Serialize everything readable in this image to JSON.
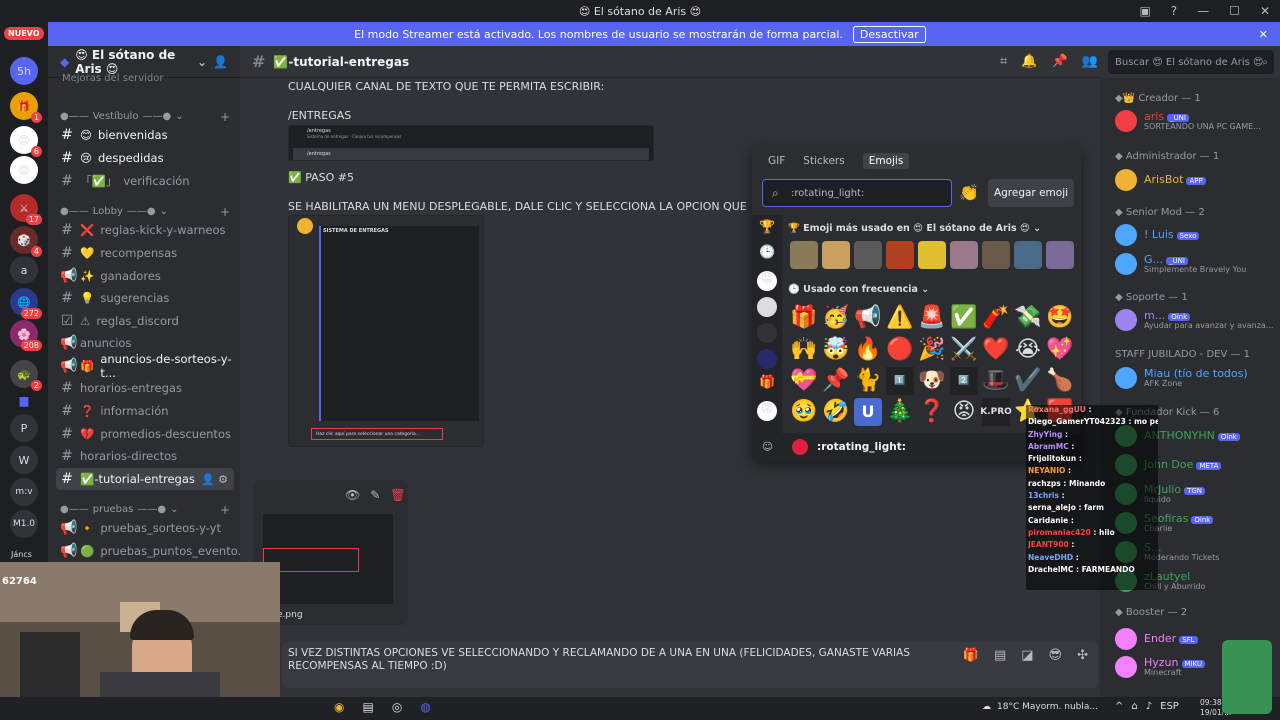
{
  "window": {
    "title": "😍 El sótano de Aris 😍"
  },
  "streamer": {
    "message": "El modo Streamer está activado. Los nombres de usuario se mostrarán de forma parcial.",
    "button": "Desactivar"
  },
  "guilds": {
    "nuevo": "NUEVO",
    "badges": [
      "1",
      "6",
      "17",
      "4",
      "272",
      "208",
      "2"
    ],
    "letters": [
      "a",
      "P",
      "W",
      "m:v",
      "M1.0",
      "Jáncs"
    ],
    "counter": "62764"
  },
  "server": {
    "name": "😍 El sótano de Aris 😍",
    "prev_item": "Mejoras del servidor"
  },
  "categories": {
    "vestibulo": "Vestíbulo",
    "lobby": "Lobby",
    "pruebas": "pruebas"
  },
  "channels": [
    {
      "label": "bienvenidas",
      "emoji": "😊"
    },
    {
      "label": "despedidas",
      "emoji": "😢"
    },
    {
      "label": "verificación",
      "emoji": "✅"
    },
    {
      "label": "reglas-kick-y-warneos",
      "emoji": "❌"
    },
    {
      "label": "recompensas",
      "emoji": "💛"
    },
    {
      "label": "ganadores",
      "emoji": "✨"
    },
    {
      "label": "sugerencias",
      "emoji": "💡"
    },
    {
      "label": "reglas_discord",
      "emoji": "⚠"
    },
    {
      "label": "anuncios",
      "emoji": ""
    },
    {
      "label": "anuncios-de-sorteos-y-t...",
      "emoji": "🎁"
    },
    {
      "label": "horarios-entregas",
      "emoji": ""
    },
    {
      "label": "información",
      "emoji": "❓"
    },
    {
      "label": "promedios-descuentos",
      "emoji": "💔"
    },
    {
      "label": "horarios-directos",
      "emoji": ""
    },
    {
      "label": "✅-tutorial-entregas",
      "emoji": ""
    },
    {
      "label": "pruebas_sorteos-y-yt",
      "emoji": "🔸"
    },
    {
      "label": "pruebas_puntos_evento...",
      "emoji": "🟢"
    }
  ],
  "channel": {
    "name": "✅-tutorial-entregas"
  },
  "search": {
    "placeholder": "Buscar 😍 El sótano de Aris 😍"
  },
  "messages": {
    "line1": "CUALQUIER CANAL DE TEXTO QUE TE PERMITA ESCRIBIR:",
    "line2": "/ENTREGAS",
    "paso": "PASO #5",
    "line3": "SE HABILITARA UN MENU DESPLEGABLE, DALE CLIC Y SELECCIONA LA OPCION QUE CORRESPONDA",
    "file": "e.png",
    "composer": "SI VEZ DISTINTAS OPCIONES VE SELECCIONANDO Y RECLAMANDO DE A UNA EN UNA (FELICIDADES, GANASTE VARIAS RECOMPENSAS AL TIEMPO :D)"
  },
  "shot1": {
    "title": "/entregas",
    "sub": "Sistema de entregas · Canjea tus recompensas",
    "input": "/entregas"
  },
  "shot2": {
    "title": "SISTEMA DE ENTREGAS",
    "select": "Haz clic aquí para seleccionar una categoría..."
  },
  "picker": {
    "tabs": [
      "GIF",
      "Stickers",
      "Emojis"
    ],
    "search": ":rotating_light:",
    "add": "Agregar emoji",
    "sec_server": "Emoji más usado en 😍 El sótano de Aris 😍",
    "sec_freq": "Usado con frecuencia",
    "row1": [
      "🎁",
      "🥳",
      "📢",
      "⚠️",
      "🚨",
      "✅",
      "🧨",
      "💸",
      "🤩"
    ],
    "row2": [
      "🙌",
      "🤯",
      "🔥",
      "🔴",
      "🎉",
      "⚔️",
      "❤️",
      "😭",
      "💖"
    ],
    "row3": [
      "💝",
      "📌",
      "🐈",
      "1️⃣",
      "🐶",
      "2️⃣",
      "🎩",
      "✔️",
      "🍗"
    ],
    "row4": [
      "🥹",
      "🤣",
      "U",
      "🎄",
      "❓",
      "😡",
      "K.PRO",
      "⭐",
      "🟥"
    ],
    "footer": ":rotating_light:"
  },
  "members": {
    "creador": "Creador — 1",
    "admin": "Administrador — 1",
    "senior": "Senior Mod — 2",
    "soporte": "Soporte — 1",
    "staff": "STAFF JUBILADO - DEV — 1",
    "fundador": "Fundador Kick — 6",
    "booster": "Booster — 2",
    "list": [
      {
        "name": "aris",
        "tag": "_UNI",
        "status": "SORTEANDO UNA PC GAME...",
        "color": "#f23f43"
      },
      {
        "name": "ArisBot",
        "tag": "APP",
        "status": "",
        "color": "#f0b232"
      },
      {
        "name": "! Luis",
        "tag": "Sexo",
        "status": "",
        "color": "#4ea6ff"
      },
      {
        "name": "G...",
        "tag": "_UNI",
        "status": "Simplemente Bravely You",
        "color": "#4ea6ff"
      },
      {
        "name": "m...",
        "tag": "Oink",
        "status": "Ayudar para avanzar y avanza...",
        "color": "#9b84ee"
      },
      {
        "name": "Miau (tío de todos)",
        "tag": "",
        "status": "AFK Zone",
        "color": "#4ea6ff"
      },
      {
        "name": "ANTHONYHN",
        "tag": "Oink",
        "status": "",
        "color": "#3ba55d"
      },
      {
        "name": "John Doe",
        "tag": "META",
        "status": "",
        "color": "#3ba55d"
      },
      {
        "name": "MrJulio",
        "tag": "TGN",
        "status": "liquido",
        "color": "#3ba55d"
      },
      {
        "name": "Seofiras",
        "tag": "Oink",
        "status": "Charlie",
        "color": "#3ba55d"
      },
      {
        "name": "S...",
        "tag": "",
        "status": "Moderando Tickets",
        "color": "#3ba55d"
      },
      {
        "name": "zLautyel",
        "tag": "",
        "status": "Chill y Aburrido",
        "color": "#3ba55d"
      },
      {
        "name": "Ender",
        "tag": "SFL",
        "status": "",
        "color": "#f47fff"
      },
      {
        "name": "Hyzun",
        "tag": "MIKU",
        "status": "Minecraft",
        "color": "#f47fff"
      }
    ]
  },
  "chatlog": [
    {
      "user": "Roxana_ggUU",
      "msg": ":",
      "color": "#ff7070"
    },
    {
      "user": "Diego_GamerYT042323",
      "msg": ": mo perma",
      "color": "#ffffff"
    },
    {
      "user": "ZhyYing",
      "msg": ":",
      "color": "#b98cff"
    },
    {
      "user": "AbramMC",
      "msg": ":",
      "color": "#b98cff"
    },
    {
      "user": "Frijolitokun",
      "msg": ":",
      "color": "#ffffff"
    },
    {
      "user": "NEYANIO",
      "msg": ":",
      "color": "#ff9a3c"
    },
    {
      "user": "rachzps",
      "msg": ": Minando",
      "color": "#ffffff"
    },
    {
      "user": "13chris",
      "msg": ":",
      "color": "#7aa8ff"
    },
    {
      "user": "serna_alejo",
      "msg": ": farm",
      "color": "#ffffff"
    },
    {
      "user": "Caridanie",
      "msg": ":",
      "color": "#ffffff"
    },
    {
      "user": "piromaniac420",
      "msg": ": hilo",
      "color": "#ff4040"
    },
    {
      "user": "JEANT900",
      "msg": ":",
      "color": "#ff4040"
    },
    {
      "user": "NeaveDHD",
      "msg": ":",
      "color": "#7aa8ff"
    },
    {
      "user": "DrachelMC",
      "msg": ": FARMEANDO",
      "color": "#ffffff"
    }
  ],
  "taskbar": {
    "weather": "18°C Mayorm. nubla...",
    "lang": "ESP",
    "time": "09:38",
    "date": "19/01/..."
  },
  "colors": {
    "accent": "#5865f2",
    "bg": "#313338",
    "sidebar": "#2b2d31"
  }
}
